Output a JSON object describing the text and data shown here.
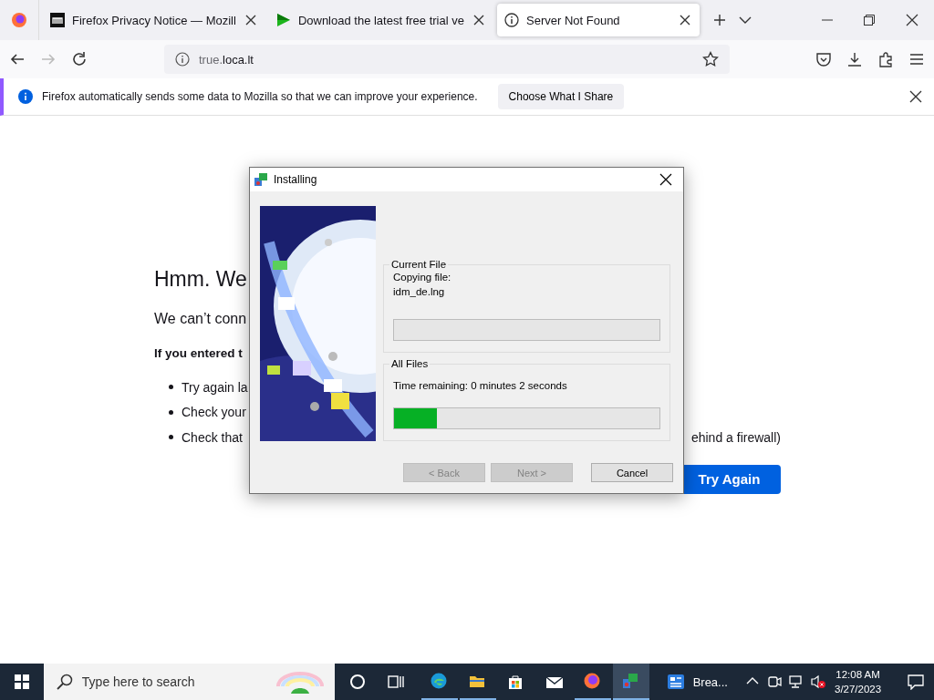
{
  "browser": {
    "tabs": [
      {
        "kind": "mozilla",
        "label": "Firefox Privacy Notice — Mozill",
        "selected": false
      },
      {
        "kind": "download",
        "label": "Download the latest free trial ve",
        "selected": false
      },
      {
        "kind": "info",
        "label": "Server Not Found",
        "selected": true
      }
    ],
    "address": {
      "subdomain": "true.",
      "domain": "loca.lt"
    },
    "notification": {
      "message": "Firefox automatically sends some data to Mozilla so that we can improve your experience.",
      "button": "Choose What I Share"
    }
  },
  "error_page": {
    "heading": "Hmm. We",
    "intro": "We can’t conn",
    "advice": "If you entered t",
    "bullets": [
      {
        "text": "Try again la"
      },
      {
        "text": "Check your"
      },
      {
        "text": "Check that",
        "text_end": "ehind a firewall)"
      }
    ],
    "button": "Try Again"
  },
  "dialog": {
    "title": "Installing",
    "current_file": {
      "legend": "Current File",
      "line_1": "Copying file:",
      "line_2": "idm_de.lng",
      "level": 0
    },
    "all_files": {
      "legend": "All Files",
      "status": "Time remaining: 0 minutes 2 seconds",
      "level": 0.16
    },
    "buttons": [
      {
        "label": "< Back",
        "disabled": true
      },
      {
        "label": "Next >",
        "disabled": true
      },
      {
        "label": "Cancel",
        "disabled": false
      }
    ]
  },
  "taskbar": {
    "search_placeholder": "Type here to search",
    "apps": [
      {
        "kind": "cortana",
        "running": false,
        "selected": false
      },
      {
        "kind": "taskview",
        "running": false,
        "selected": false
      },
      {
        "kind": "edge",
        "running": true,
        "selected": false
      },
      {
        "kind": "explorer",
        "running": true,
        "selected": false
      },
      {
        "kind": "store",
        "running": false,
        "selected": false
      },
      {
        "kind": "mail",
        "running": false,
        "selected": false
      },
      {
        "kind": "firefox",
        "running": true,
        "selected": false
      },
      {
        "kind": "installer",
        "running": true,
        "selected": true
      }
    ],
    "window_button": "Brea...",
    "time": "12:08 AM",
    "date": "3/27/2023"
  }
}
